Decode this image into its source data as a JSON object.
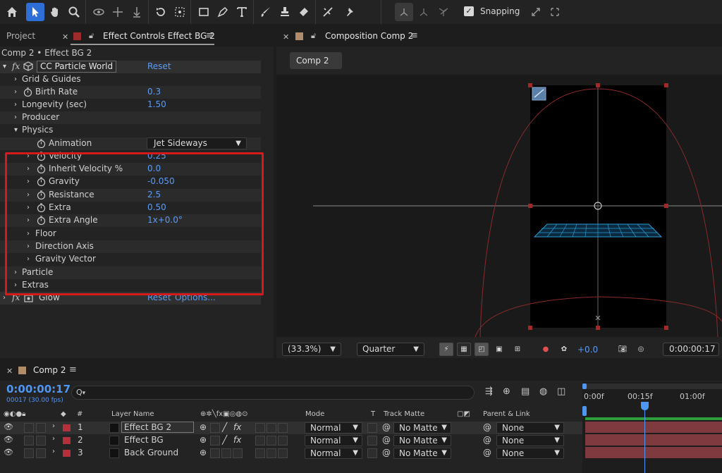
{
  "toolbar": {
    "snapping_label": "Snapping"
  },
  "effect_controls": {
    "tab_project": "Project",
    "tab_effect_controls": "Effect Controls Effect BG 2",
    "subtitle": "Comp 2 • Effect BG 2",
    "effect1": {
      "name": "CC Particle World",
      "reset": "Reset"
    },
    "rows": {
      "grid_guides": "Grid & Guides",
      "birth_rate": {
        "label": "Birth Rate",
        "value": "0.3"
      },
      "longevity": {
        "label": "Longevity (sec)",
        "value": "1.50"
      },
      "producer": "Producer",
      "physics": "Physics",
      "animation": {
        "label": "Animation",
        "value": "Jet Sideways"
      },
      "velocity": {
        "label": "Velocity",
        "value": "0.25"
      },
      "inherit_velocity": {
        "label": "Inherit Velocity %",
        "value": "0.0"
      },
      "gravity": {
        "label": "Gravity",
        "value": "-0.050"
      },
      "resistance": {
        "label": "Resistance",
        "value": "2.5"
      },
      "extra": {
        "label": "Extra",
        "value": "0.50"
      },
      "extra_angle": {
        "label": "Extra Angle",
        "value": "1x+0.0°"
      },
      "floor": "Floor",
      "direction_axis": "Direction Axis",
      "gravity_vector": "Gravity Vector",
      "particle": "Particle",
      "extras": "Extras"
    },
    "effect2": {
      "name": "Glow",
      "reset": "Reset",
      "options": "Options..."
    }
  },
  "composition": {
    "tab_label": "Composition Comp 2",
    "comp_button": "Comp 2",
    "zoom": "(33.3%)",
    "resolution": "Quarter",
    "exposure": "+0.0",
    "timecode": "0:00:00:17"
  },
  "timeline": {
    "tab_label": "Comp 2",
    "current_time": "0:00:00:17",
    "fps_note": "00017 (30.00 fps)",
    "search_placeholder": "Q",
    "headers": {
      "num": "#",
      "layer_name": "Layer Name",
      "mode": "Mode",
      "t": "T",
      "track_matte": "Track Matte",
      "parent_link": "Parent & Link"
    },
    "ruler": [
      "0:00f",
      "00:15f",
      "01:00f"
    ],
    "layers": [
      {
        "num": "1",
        "name": "Effect BG 2",
        "mode": "Normal",
        "matte": "No Matte",
        "parent": "None"
      },
      {
        "num": "2",
        "name": "Effect BG",
        "mode": "Normal",
        "matte": "No Matte",
        "parent": "None"
      },
      {
        "num": "3",
        "name": "Back Ground",
        "mode": "Normal",
        "matte": "No Matte",
        "parent": "None"
      }
    ]
  },
  "colors": {
    "accent_blue": "#2d6fd6",
    "value_blue": "#5a9cf5",
    "highlight_red": "#d61a1a",
    "layer_red": "#b5303a"
  }
}
